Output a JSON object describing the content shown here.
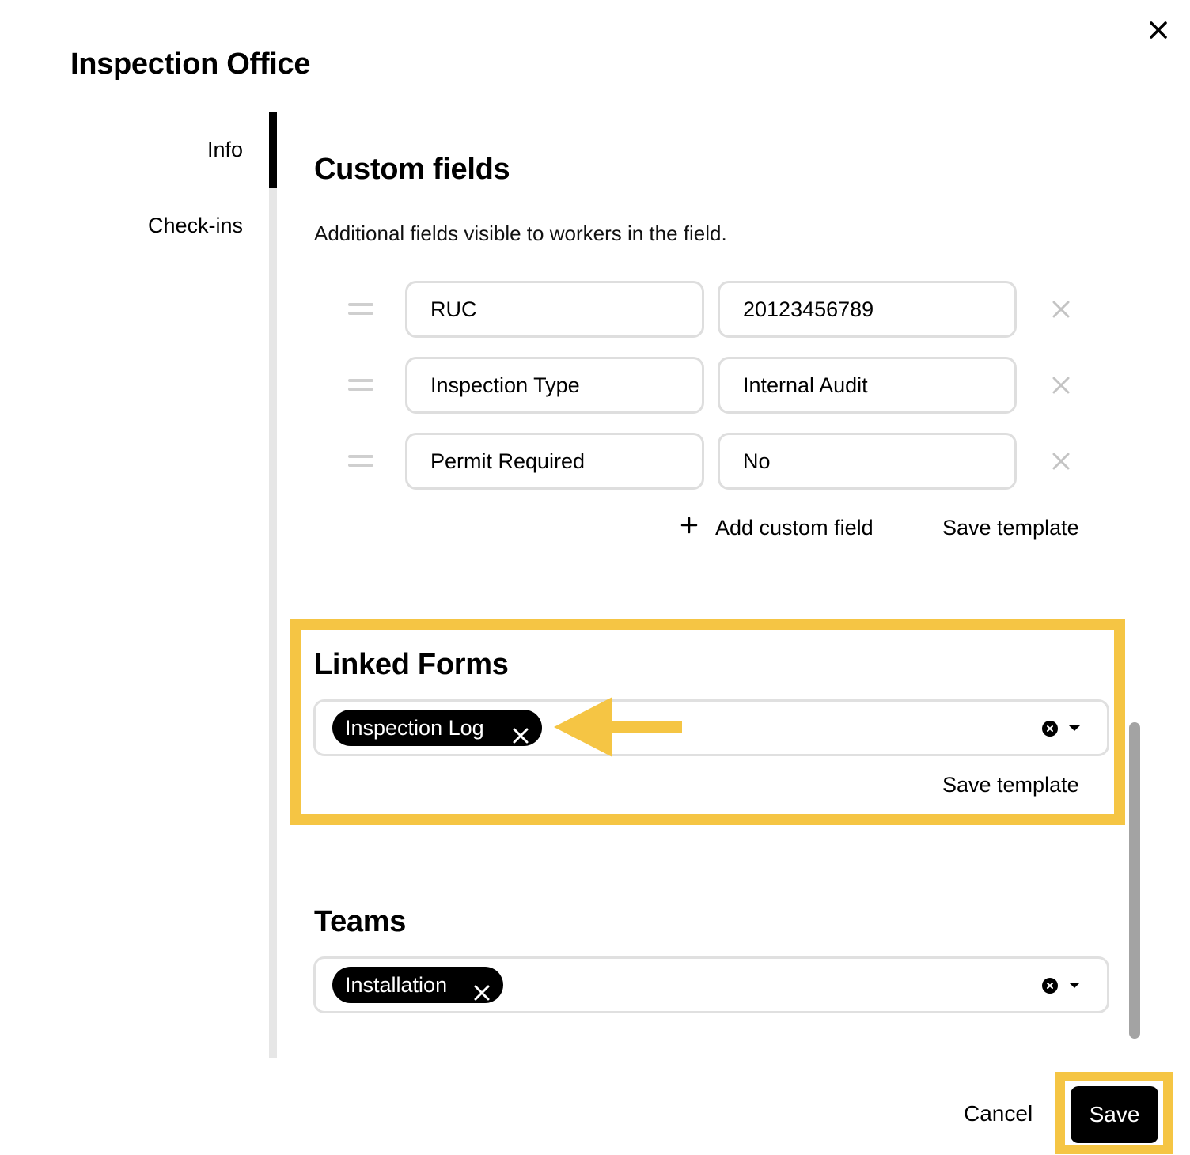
{
  "modal": {
    "title": "Inspection Office",
    "close_icon": "close-icon"
  },
  "nav": {
    "items": [
      {
        "label": "Info",
        "active": true
      },
      {
        "label": "Check-ins",
        "active": false
      }
    ]
  },
  "custom_fields": {
    "title": "Custom fields",
    "description": "Additional fields visible to workers in the field.",
    "rows": [
      {
        "name": "RUC",
        "value": "20123456789"
      },
      {
        "name": "Inspection Type",
        "value": "Internal Audit"
      },
      {
        "name": "Permit Required",
        "value": "No"
      }
    ],
    "add_label": "Add custom field",
    "save_template_label": "Save template"
  },
  "linked_forms": {
    "title": "Linked Forms",
    "selected": [
      "Inspection Log"
    ],
    "save_template_label": "Save template"
  },
  "teams": {
    "title": "Teams",
    "selected": [
      "Installation"
    ]
  },
  "footer": {
    "cancel_label": "Cancel",
    "save_label": "Save"
  },
  "colors": {
    "highlight": "#f5c544",
    "primary": "#000000",
    "border": "#dedede"
  }
}
